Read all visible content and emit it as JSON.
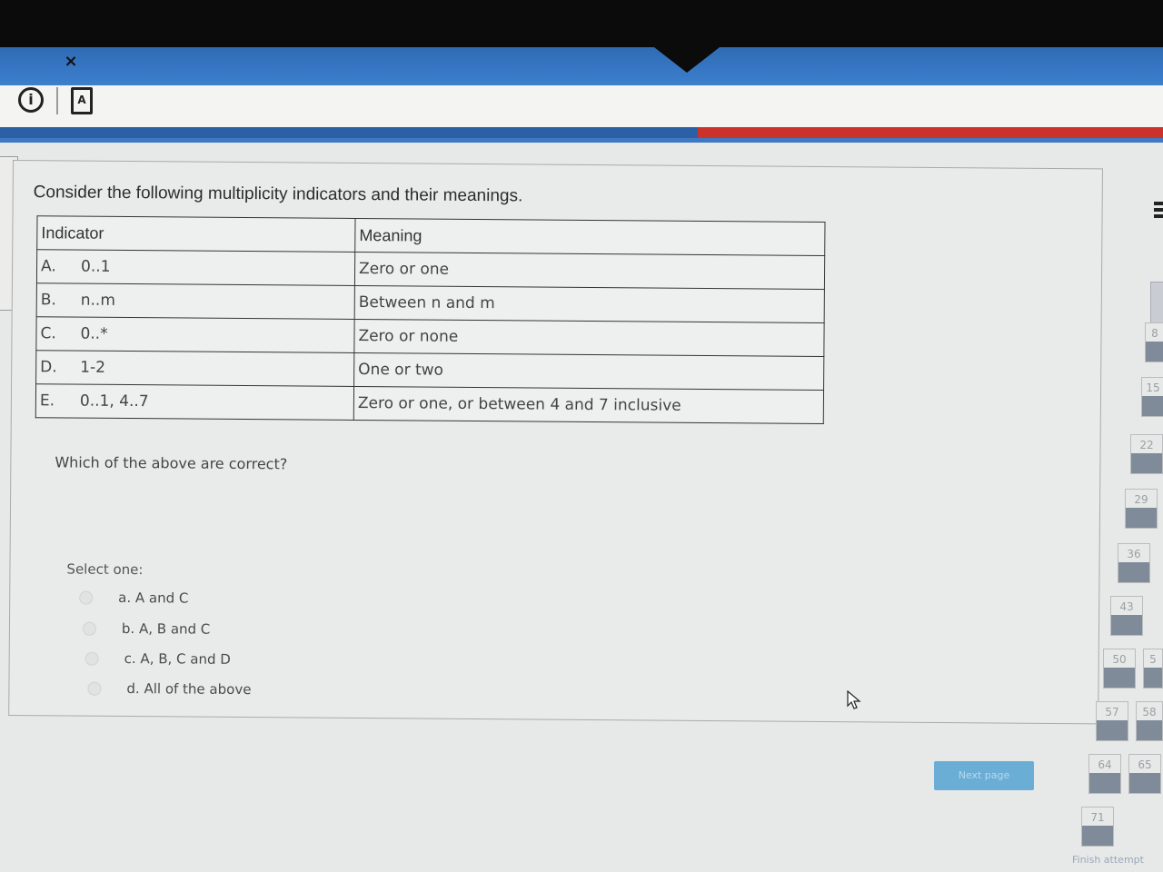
{
  "window": {
    "close_glyph": "×"
  },
  "toolbar": {
    "info_icon": "info-circle-icon",
    "info_glyph": "i",
    "doc_icon": "pdf-document-icon",
    "doc_glyph": "A"
  },
  "colors": {
    "topbar": "#3c7fcd",
    "accent_blue": "#2b5fa6",
    "accent_red": "#c9332b",
    "button": "#6aaed6"
  },
  "question": {
    "intro": "Consider the following multiplicity indicators and their meanings.",
    "table": {
      "headers": [
        "Indicator",
        "Meaning"
      ],
      "rows": [
        {
          "letter": "A.",
          "indicator": "0..1",
          "meaning": "Zero or one"
        },
        {
          "letter": "B.",
          "indicator": "n..m",
          "meaning": "Between n and m"
        },
        {
          "letter": "C.",
          "indicator": "0..*",
          "meaning": "Zero or none"
        },
        {
          "letter": "D.",
          "indicator": "1-2",
          "meaning": "One or two"
        },
        {
          "letter": "E.",
          "indicator": "0..1, 4..7",
          "meaning": "Zero or one, or between 4 and 7 inclusive"
        }
      ]
    },
    "prompt": "Which of the above are correct?",
    "select_label": "Select one:",
    "options": [
      {
        "label": "a. A and C",
        "selected": false
      },
      {
        "label": "b. A, B and C",
        "selected": false
      },
      {
        "label": "c. A, B, C and D",
        "selected": false
      },
      {
        "label": "d. All of the above",
        "selected": false
      }
    ]
  },
  "footer": {
    "next_button": "Next page"
  },
  "quiz_navigation": {
    "tiles": [
      "8",
      "15",
      "22",
      "29",
      "36",
      "43",
      "50",
      "5",
      "57",
      "58",
      "64",
      "65",
      "71"
    ],
    "finish_link": "Finish attempt"
  }
}
